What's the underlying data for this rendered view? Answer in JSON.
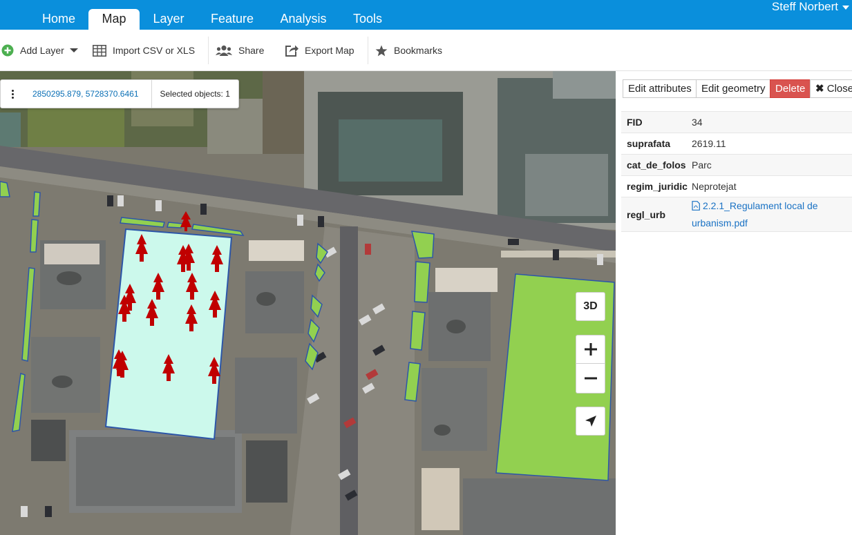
{
  "nav": {
    "tabs": [
      {
        "label": "Home"
      },
      {
        "label": "Map"
      },
      {
        "label": "Layer"
      },
      {
        "label": "Feature"
      },
      {
        "label": "Analysis"
      },
      {
        "label": "Tools"
      }
    ],
    "active_tab": "Map",
    "user": "Steff Norbert"
  },
  "toolbar": {
    "add_layer": "Add Layer",
    "import_csv": "Import CSV or XLS",
    "share": "Share",
    "export_map": "Export Map",
    "bookmarks": "Bookmarks"
  },
  "map": {
    "coordinates": "2850295.879, 5728370.6461",
    "selected_objects": "Selected objects: 1",
    "btn_3d": "3D",
    "zoom_in": "+",
    "zoom_out": "−"
  },
  "panel": {
    "edit_attributes": "Edit attributes",
    "edit_geometry": "Edit geometry",
    "delete": "Delete",
    "close": "Close",
    "attributes": [
      {
        "key": "FID",
        "value": "34"
      },
      {
        "key": "suprafata",
        "value": "2619.11"
      },
      {
        "key": "cat_de_folos",
        "value": "Parc"
      },
      {
        "key": "regim_juridic",
        "value": "Neprotejat"
      },
      {
        "key": "regl_urb",
        "value": "2.2.1_Regulament local de urbanism.pdf"
      }
    ]
  },
  "colors": {
    "header": "#0a8fdc",
    "park_selected": "#ccf9ec",
    "green_area": "#92d050",
    "tree": "#c00000",
    "delete": "#d9534f",
    "link": "#1a72c4"
  }
}
